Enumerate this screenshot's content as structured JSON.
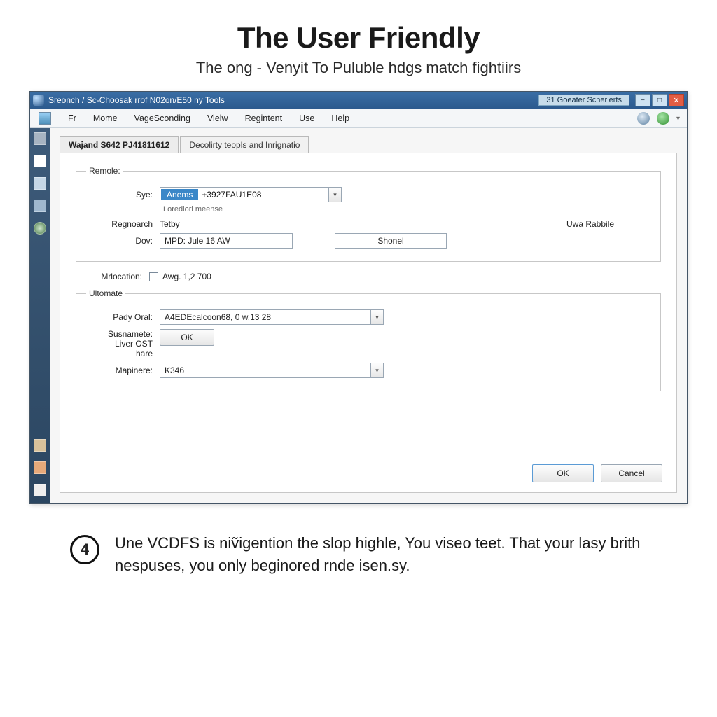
{
  "heading": {
    "title": "The User Friendly",
    "subtitle": "The ong - Venyit To Puluble hdgs match fightiirs"
  },
  "window": {
    "title": "Sreonch / Sc-Choosak rrof N02on/E50 ny Tools",
    "right_label": "31 Goeater Scherlerts"
  },
  "menu": {
    "items": [
      "Fr",
      "Mome",
      "VageSconding",
      "Vielw",
      "Regintent",
      "Use",
      "Help"
    ]
  },
  "tabs": [
    {
      "label": "Wajand S642 PJ41811612",
      "active": true
    },
    {
      "label": "Decolirty teopls and Inrignatio",
      "active": false
    }
  ],
  "remole": {
    "legend": "Remole:",
    "sye_label": "Sye:",
    "sye_chip": "Anems",
    "sye_rest": "+3927FAU1E08",
    "sye_subnote": "Lorediori meense",
    "regnoarch_label": "Regnoarch",
    "dov_label": "Dov:",
    "tetby_label": "Tetby",
    "mpd_value": "MPD: Jule 16 AW",
    "uwa_label": "Uwa Rabbile",
    "shonel_value": "Shonel"
  },
  "mrlocation": {
    "label": "Mrlocation:",
    "checkbox_label": "Awg. 1,2 700"
  },
  "ultomate": {
    "legend": "Ultomate",
    "pady_label": "Pady Oral:",
    "pady_value": "A4EDEcalcoon68, 0 w.13 28",
    "susna_label1": "Susnamete:",
    "susna_label2": "Liver OST",
    "susna_label3": "hare",
    "ok_label": "OK",
    "map_label": "Mapinere:",
    "map_value": "K346"
  },
  "dialog": {
    "ok": "OK",
    "cancel": "Cancel"
  },
  "footnote": {
    "step": "4",
    "text": "Une VCDFS is niṽigention the slop highle, You viseo teet. That your lasy brith nespuses, you only beginored rnde isen.sy."
  }
}
